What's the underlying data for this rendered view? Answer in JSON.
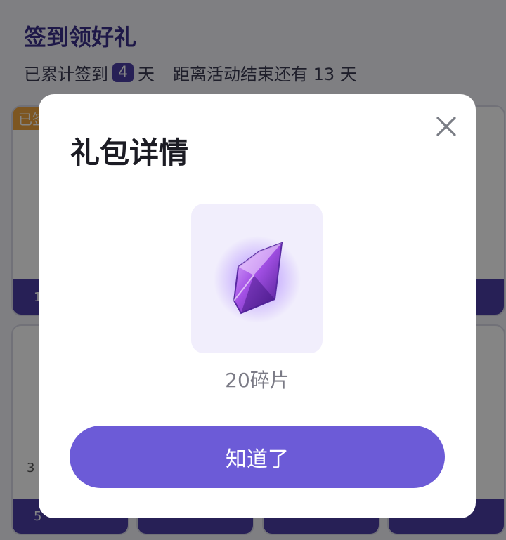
{
  "page": {
    "title": "签到领好礼",
    "summary": {
      "prefix": "已累计签到",
      "signed_days": "4",
      "unit": "天",
      "remain_text": "距离活动结束还有 13 天"
    },
    "cards": [
      {
        "ribbon": "已签",
        "foot": "1"
      },
      {
        "mid": "3",
        "foot": "5"
      }
    ]
  },
  "modal": {
    "title": "礼包详情",
    "item": {
      "icon": "purple-crystal-icon",
      "label": "20碎片"
    },
    "confirm_label": "知道了",
    "close_icon": "close-icon"
  },
  "colors": {
    "accent": "#6c5bd7",
    "dark_purple": "#4b3fa6",
    "ribbon": "#f0a640"
  }
}
